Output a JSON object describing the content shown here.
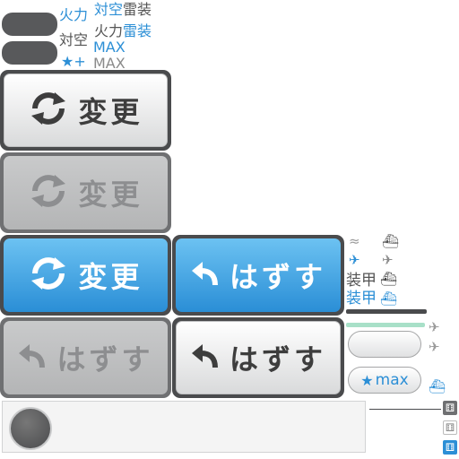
{
  "stats": {
    "row1": {
      "a": "火力",
      "b": "対空",
      "c": "雷装"
    },
    "row2": {
      "a": "対空",
      "b": "火力",
      "c": "雷装"
    },
    "row3": {
      "a": "MAX"
    },
    "row4": {
      "a": "+",
      "b": "MAX"
    }
  },
  "buttons": {
    "change_label": "変更",
    "remove_label": "はずす"
  },
  "equip": {
    "armor_label": "装甲",
    "max_label": "max"
  },
  "colors": {
    "accent_blue": "#2c8fd6",
    "frame_dark": "#4a4b4d",
    "disabled_gray": "#b4b5b6"
  },
  "icons": {
    "refresh": "refresh-icon",
    "back_arrow": "back-arrow-icon",
    "star": "star-icon",
    "torpedo": "torpedo-icon",
    "plane": "plane-icon",
    "ship": "ship-icon",
    "dice": "dice-icon"
  }
}
